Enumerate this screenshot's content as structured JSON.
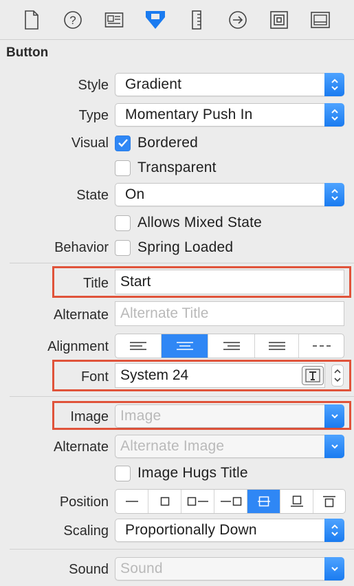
{
  "toolbar": {
    "items": [
      "file-inspector-icon",
      "help-inspector-icon",
      "identity-inspector-icon",
      "attributes-inspector-icon",
      "size-inspector-icon",
      "connections-inspector-icon",
      "bindings-inspector-icon",
      "view-effects-inspector-icon"
    ],
    "selected": "attributes-inspector-icon",
    "accent_color": "#1a7bf0"
  },
  "section": {
    "title": "Button"
  },
  "fields": {
    "style": {
      "label": "Style",
      "value": "Gradient"
    },
    "type": {
      "label": "Type",
      "value": "Momentary Push In"
    },
    "visual": {
      "label": "Visual",
      "bordered_label": "Bordered",
      "bordered_checked": true,
      "transparent_label": "Transparent",
      "transparent_checked": false
    },
    "state": {
      "label": "State",
      "value": "On",
      "mixed_label": "Allows Mixed State",
      "mixed_checked": false
    },
    "behavior": {
      "label": "Behavior",
      "spring_label": "Spring Loaded",
      "spring_checked": false
    },
    "title": {
      "label": "Title",
      "value": "Start"
    },
    "alternate_title": {
      "label": "Alternate",
      "placeholder": "Alternate Title"
    },
    "alignment": {
      "label": "Alignment",
      "options": [
        "left",
        "center",
        "right",
        "justified",
        "natural"
      ],
      "selected": "center"
    },
    "font": {
      "label": "Font",
      "value": "System 24"
    },
    "image": {
      "label": "Image",
      "placeholder": "Image"
    },
    "alternate_image": {
      "label": "Alternate",
      "placeholder": "Alternate Image"
    },
    "image_hugs": {
      "label": "Image Hugs Title",
      "checked": false
    },
    "position": {
      "label": "Position",
      "options": [
        "no-image",
        "image-only",
        "image-left",
        "image-right",
        "image-overlaps",
        "image-below",
        "image-above"
      ],
      "selected": "image-overlaps"
    },
    "scaling": {
      "label": "Scaling",
      "value": "Proportionally Down"
    },
    "sound": {
      "label": "Sound",
      "placeholder": "Sound"
    }
  },
  "highlight_color": "#e0533a"
}
